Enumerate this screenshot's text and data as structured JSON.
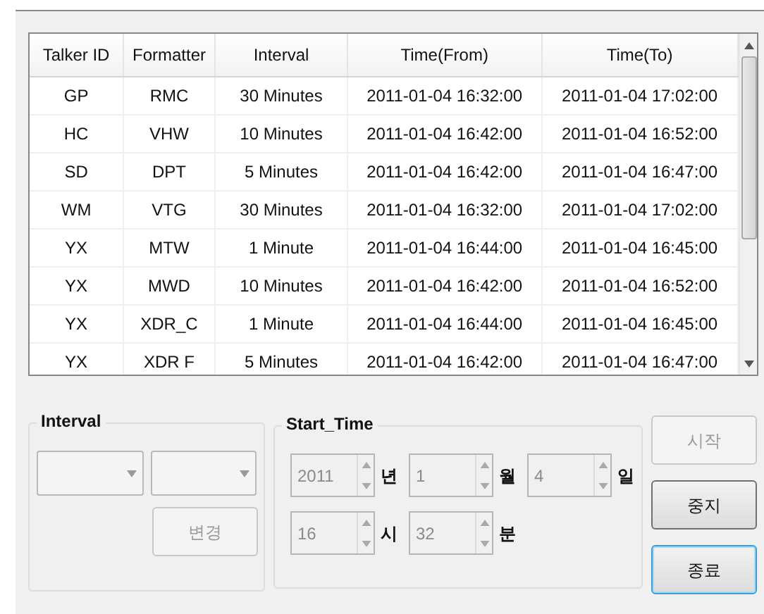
{
  "table": {
    "columns": [
      "Talker ID",
      "Formatter",
      "Interval",
      "Time(From)",
      "Time(To)"
    ],
    "rows": [
      [
        "GP",
        "RMC",
        "30 Minutes",
        "2011-01-04 16:32:00",
        "2011-01-04 17:02:00"
      ],
      [
        "HC",
        "VHW",
        "10 Minutes",
        "2011-01-04 16:42:00",
        "2011-01-04 16:52:00"
      ],
      [
        "SD",
        "DPT",
        "5 Minutes",
        "2011-01-04 16:42:00",
        "2011-01-04 16:47:00"
      ],
      [
        "WM",
        "VTG",
        "30 Minutes",
        "2011-01-04 16:32:00",
        "2011-01-04 17:02:00"
      ],
      [
        "YX",
        "MTW",
        "1 Minute",
        "2011-01-04 16:44:00",
        "2011-01-04 16:45:00"
      ],
      [
        "YX",
        "MWD",
        "10 Minutes",
        "2011-01-04 16:42:00",
        "2011-01-04 16:52:00"
      ],
      [
        "YX",
        "XDR_C",
        "1 Minute",
        "2011-01-04 16:44:00",
        "2011-01-04 16:45:00"
      ],
      [
        "YX",
        "XDR F",
        "5 Minutes",
        "2011-01-04 16:42:00",
        "2011-01-04 16:47:00"
      ]
    ]
  },
  "interval_group": {
    "title": "Interval",
    "dropdowns": [
      {
        "disabled": true
      },
      {
        "disabled": true
      }
    ],
    "button": {
      "label": "변경",
      "disabled": true
    }
  },
  "start_time": {
    "title": "Start_Time",
    "fields": [
      {
        "value": "2011",
        "unit": "년",
        "disabled": true
      },
      {
        "value": "1",
        "unit": "월",
        "disabled": true
      },
      {
        "value": "4",
        "unit": "일",
        "disabled": true
      },
      {
        "value": "16",
        "unit": "시",
        "disabled": true
      },
      {
        "value": "32",
        "unit": "분",
        "disabled": true
      }
    ]
  },
  "buttons": [
    {
      "label": "시작",
      "disabled": true,
      "focused": false
    },
    {
      "label": "중지",
      "disabled": false,
      "focused": false
    },
    {
      "label": "종료",
      "disabled": false,
      "focused": true
    }
  ]
}
